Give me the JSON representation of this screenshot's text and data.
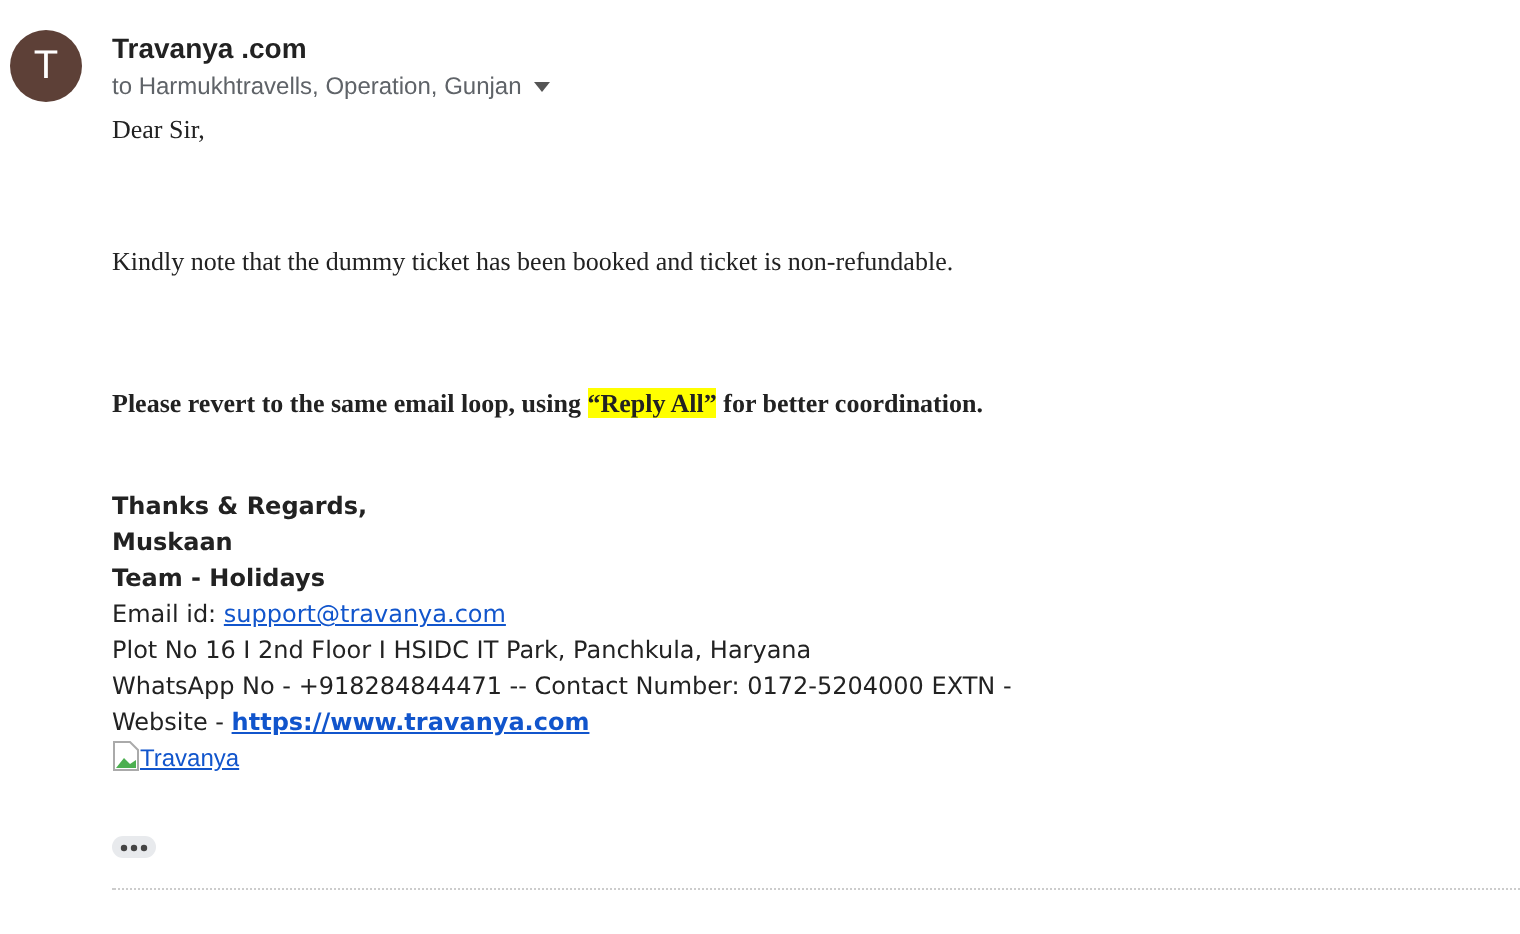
{
  "sender": {
    "initial": "T",
    "name": "Travanya .com",
    "recipients": "to Harmukhtravells, Operation, Gunjan"
  },
  "body": {
    "greeting": "Dear Sir,",
    "note": "Kindly note that the dummy ticket has been booked and ticket is non-refundable.",
    "request": {
      "before": "Please revert to the same email loop, using ",
      "highlight": "“Reply All”",
      "after": " for better coordination."
    }
  },
  "signature": {
    "closing": "Thanks & Regards,",
    "name": "Muskaan",
    "team": "Team - Holidays",
    "email_label": "Email id: ",
    "email": "support@travanya.com",
    "address": "Plot No 16 I 2nd Floor I HSIDC IT Park, Panchkula, Haryana",
    "phone": "WhatsApp No - +918284844471 -- Contact Number: 0172-5204000 EXTN -",
    "website_label": "Website - ",
    "website": "https://www.travanya.com",
    "logo_alt": "Travanya"
  }
}
